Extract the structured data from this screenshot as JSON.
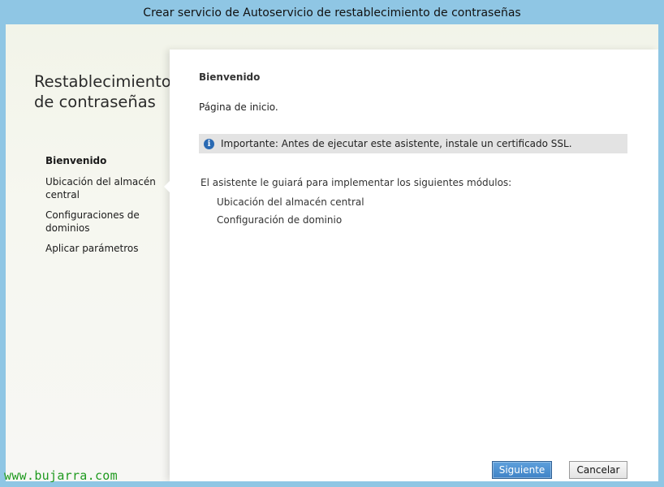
{
  "window": {
    "title": "Crear servicio de Autoservicio de restablecimiento de contraseñas"
  },
  "sidebar": {
    "title": "Restablecimiento de contraseñas",
    "items": [
      {
        "label": "Bienvenido",
        "active": true
      },
      {
        "label": "Ubicación del almacén central",
        "active": false
      },
      {
        "label": "Configuraciones de dominios",
        "active": false
      },
      {
        "label": "Aplicar parámetros",
        "active": false
      }
    ]
  },
  "main": {
    "heading": "Bienvenido",
    "subheading": "Página de inicio.",
    "info": {
      "icon": "info-icon",
      "text": "Importante: Antes de ejecutar este asistente, instale un certificado SSL."
    },
    "intro": "El asistente le guiará para implementar los siguientes módulos:",
    "modules": [
      "Ubicación del almacén central",
      "Configuración de dominio"
    ]
  },
  "buttons": {
    "next": "Siguiente",
    "cancel": "Cancelar"
  },
  "watermark": "www.bujarra.com",
  "colors": {
    "frame": "#8fc6e4",
    "primary_button": "#3f83c6",
    "info_bar": "#e3e3e3",
    "watermark": "#1f9a1f"
  }
}
